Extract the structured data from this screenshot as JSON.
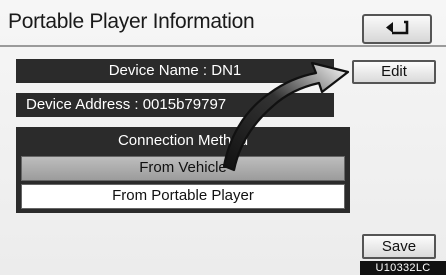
{
  "header": {
    "title": "Portable Player Information",
    "back_icon": "back-arrow-icon"
  },
  "device": {
    "name_text": "Device Name : DN1",
    "address_text": "Device Address : 0015b79797",
    "edit_label": "Edit"
  },
  "connection": {
    "label": "Connection Method",
    "options": [
      {
        "label": "From Vehicle",
        "selected": true
      },
      {
        "label": "From Portable Player",
        "selected": false
      }
    ]
  },
  "footer": {
    "save_label": "Save",
    "figure_code": "U10332LC"
  },
  "colors": {
    "panel_dark": "#2b2b2b",
    "selected_option": "#a8a8a8",
    "background": "#efefef"
  }
}
